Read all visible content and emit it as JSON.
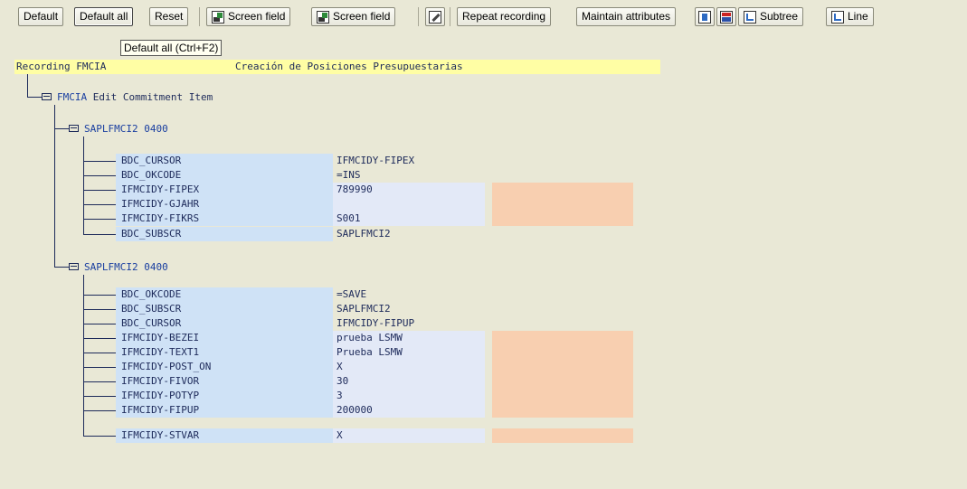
{
  "toolbar": {
    "default_label": "Default",
    "default_all_label": "Default all",
    "reset_label": "Reset",
    "screen_field_1_label": "Screen field",
    "screen_field_2_label": "Screen field",
    "repeat_recording_label": "Repeat recording",
    "maintain_attributes_label": "Maintain attributes",
    "subtree_label": "Subtree",
    "line_label": "Line"
  },
  "tooltip": "Default all  (Ctrl+F2)",
  "recording": {
    "label": "Recording FMCIA",
    "description": "Creación de Posiciones Presupuestarias"
  },
  "transaction": {
    "code": "FMCIA",
    "text": "Edit Commitment Item"
  },
  "screens": [
    {
      "label": "SAPLFMCI2 0400",
      "fields": [
        {
          "name": "BDC_CURSOR",
          "value": "IFMCIDY-FIPEX",
          "input": false
        },
        {
          "name": "BDC_OKCODE",
          "value": "=INS",
          "input": false
        },
        {
          "name": "IFMCIDY-FIPEX",
          "value": "789990",
          "input": true
        },
        {
          "name": "IFMCIDY-GJAHR",
          "value": "",
          "input": true
        },
        {
          "name": "IFMCIDY-FIKRS",
          "value": "S001",
          "input": true
        },
        {
          "name": "BDC_SUBSCR",
          "value": "SAPLFMCI2",
          "input": false
        }
      ]
    },
    {
      "label": "SAPLFMCI2 0400",
      "fields": [
        {
          "name": "BDC_OKCODE",
          "value": "=SAVE",
          "input": false
        },
        {
          "name": "BDC_SUBSCR",
          "value": "SAPLFMCI2",
          "input": false
        },
        {
          "name": "BDC_CURSOR",
          "value": "IFMCIDY-FIPUP",
          "input": false
        },
        {
          "name": "IFMCIDY-BEZEI",
          "value": "prueba LSMW",
          "input": true
        },
        {
          "name": "IFMCIDY-TEXT1",
          "value": "Prueba LSMW",
          "input": true
        },
        {
          "name": "IFMCIDY-POST_ON",
          "value": "X",
          "input": true
        },
        {
          "name": "IFMCIDY-FIVOR",
          "value": "30",
          "input": true
        },
        {
          "name": "IFMCIDY-POTYP",
          "value": "3",
          "input": true
        },
        {
          "name": "IFMCIDY-FIPUP",
          "value": "200000",
          "input": true
        },
        {
          "name": "IFMCIDY-STVAR",
          "value": "X",
          "input": true
        }
      ]
    }
  ]
}
